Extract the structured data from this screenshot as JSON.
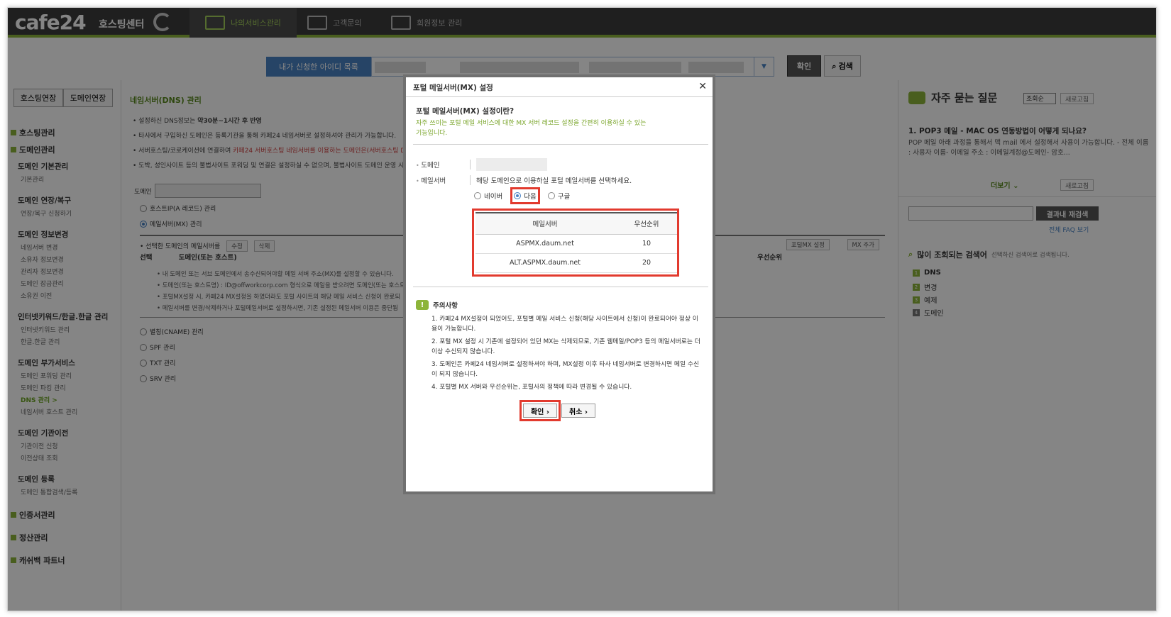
{
  "header": {
    "logo": "cafe24",
    "logo_sub": "호스팅센터",
    "nav": [
      "나의서비스관리",
      "고객문의",
      "회원정보 관리"
    ]
  },
  "search_bar": {
    "label": "내가 신청한 아이디 목록",
    "ok": "확인",
    "search": "검색"
  },
  "left": {
    "tabs": [
      "호스팅연장",
      "도메인연장"
    ],
    "cat_hosting": "호스팅관리",
    "cat_domain": "도메인관리",
    "g1": "도메인 기본관리",
    "g1_i1": "기본관리",
    "g2": "도메인 연장/복구",
    "g2_i1": "연장/복구 신청하기",
    "g3": "도메인 정보변경",
    "g3_i1": "네임서버 변경",
    "g3_i2": "소유자 정보변경",
    "g3_i3": "관리자 정보변경",
    "g3_i4": "도메인 잠금관리",
    "g3_i5": "소유권 이전",
    "g4": "인터넷키워드/한글.한글 관리",
    "g4_i1": "인터넷키워드 관리",
    "g4_i2": "한글.한글 관리",
    "g5": "도메인 부가서비스",
    "g5_i1": "도메인 포워딩 관리",
    "g5_i2": "도메인 파킹 관리",
    "g5_i3": "DNS 관리 >",
    "g5_i4": "네임서버 호스트 관리",
    "g6": "도메인 기관이전",
    "g6_i1": "기관이전 신청",
    "g6_i2": "이전상태 조회",
    "g7": "도메인 등록",
    "g7_i1": "도메인 통합검색/등록",
    "cat_cert": "인증서관리",
    "cat_settle": "정산관리",
    "cat_partner": "캐쉬백 파트너"
  },
  "main": {
    "title": "네임서버(DNS) 관리",
    "note1_a": "설정하신 DNS정보는 ",
    "note1_b": "약30분~1시간 후 반영",
    "note2": "타사에서 구입하신 도메인은 등록기관을 통해 카페24 네임서버로 설정하셔야 관리가 가능합니다.",
    "note3_a": "서버호스팅/코로케이션에 연결하여 ",
    "note3_b": "카페24 서버호스팅 네임서버를 이용하는 도메인은(서버호스팅 D",
    "note4": "도박, 성인사이트 등의 불법사이트 포워딩 및 연결은 설정하실 수 없으며, 불법사이트 도메인 운영 시",
    "domain_label": "도메인",
    "r_a": "호스트IP(A 레코드) 관리",
    "r_mx": "메일서버(MX) 관리",
    "mx_hdr": "선택한 도메인의 메일서버를",
    "mx_edit": "수정",
    "mx_del": "삭제",
    "mx_portal": "포털MX 설정",
    "mx_add": "MX 추가",
    "col_sel": "선택",
    "col_dom": "도메인(또는 호스트)",
    "col_pri": "우선순위",
    "sub1": "내 도메인 또는 서브 도메인에서 송수신되어야할 메일 서버 주소(MX)를 설정할 수 있습니다.",
    "sub2": "도메인(또는 호스트명) : ID@offworkcorp.com 형식으로 메일을 받으려면 도메인(또는 호스트",
    "sub3": "포털MX설정 시, 카페24 MX설정을 하였더라도 포털 사이트의 해당 메일 서비스 신청이 완료되",
    "sub4": "메일서버를 변경/삭제하거나 포털메일서버로 설정하시면, 기존 설정된 메일서버 이용은 중단됨",
    "r_cname": "별칭(CNAME) 관리",
    "r_spf": "SPF 관리",
    "r_txt": "TXT 관리",
    "r_srv": "SRV 관리"
  },
  "right": {
    "title": "자주 묻는 질문",
    "sort": "조회순",
    "refresh": "새로고침",
    "faq_q": "1. POP3 메일 - MAC OS 연동방법이 어떻게 되나요?",
    "faq_a": "POP 메일 아래 과정을 통해서 맥 mail 에서 설정해서 사용이 가능합니다. - 전체 이름 : 사용자 이름- 이메일 주소 : 이메일계정@도메인- 암호...",
    "more": "더보기",
    "search_btn": "결과내 재검색",
    "faq_all": "전체 FAQ 보기",
    "pop_title": "많이 조회되는 검색어",
    "pop_sub": "선택하신 검색어로 검색됩니다.",
    "kw1": "DNS",
    "kw2": "변경",
    "kw3": "예제",
    "kw4": "도메인",
    "n1": "1",
    "n2": "2",
    "n3": "3",
    "n4": "4"
  },
  "modal": {
    "title": "포털 메일서버(MX) 설정",
    "close": "✕",
    "what": "포털 메일서버(MX) 설정이란?",
    "desc": "자주 쓰이는 포털 메일 서비스에 대한 MX 서버 레코드 설정을 간편히 이용하실 수 있는 기능입니다.",
    "domain_label": "도메인",
    "mail_label": "메일서버",
    "mail_hint": "해당 도메인으로 이용하실 포털 메일서버를 선택하세요.",
    "opt_naver": "네이버",
    "opt_daum": "다음",
    "opt_google": "구글",
    "th_server": "메일서버",
    "th_priority": "우선순위",
    "rows": [
      {
        "server": "ASPMX.daum.net",
        "priority": "10"
      },
      {
        "server": "ALT.ASPMX.daum.net",
        "priority": "20"
      }
    ],
    "caution": "주의사항",
    "n1": "1. 카페24 MX설정이 되었어도, 포털별 메일 서비스 신청(해당 사이트에서 신청)이 완료되어야 정상 이용이 가능합니다.",
    "n2": "2. 포털 MX 설정 시 기존에 설정되어 있던 MX는 삭제되므로, 기존 웹메일/POP3 등의 메일서버로는 더 이상 수신되지 않습니다.",
    "n3": "3. 도메인은 카페24 네임서버로 설정하셔야 하며, MX설정 이후 타사 네임서버로 변경하시면 메일 수신이 되지 않습니다.",
    "n4": "4. 포털별 MX 서버와 우선순위는, 포털사의 정책에 따라 변경될 수 있습니다.",
    "ok": "확인 ›",
    "cancel": "취소 ›"
  }
}
